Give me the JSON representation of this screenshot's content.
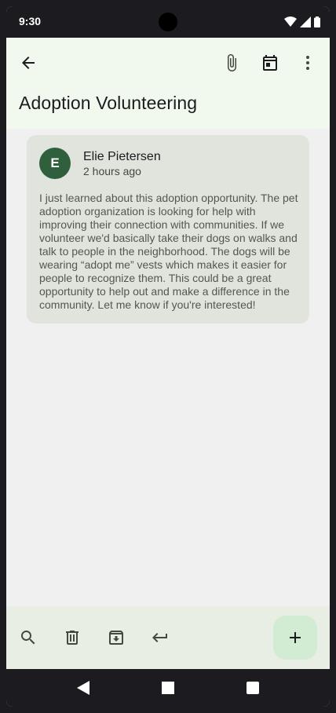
{
  "status": {
    "time": "9:30"
  },
  "header": {
    "title": "Adoption Volunteering"
  },
  "message": {
    "avatar_letter": "E",
    "sender": "Elie Pietersen",
    "time_ago": "2 hours ago",
    "body": "I just learned about this adoption opportunity. The pet adoption organization is looking for help with improving their connection with communities. If we volunteer we'd basically take their dogs on walks and talk to people in the neighborhood. The dogs will be wearing “adopt me” vests which makes it easier for people to recognize them. This could be a great opportunity to help out and make a difference in the community. Let me know if you're interested!"
  },
  "colors": {
    "avatar": "#2f5f3c",
    "top_bar": "#f1f8ee",
    "card": "#e0e4dd",
    "fab": "#d2ecd4"
  },
  "icons": {
    "top_bar": [
      "arrow-back-icon",
      "attach-icon",
      "calendar-icon",
      "more-vert-icon"
    ],
    "bottom_bar": [
      "search-icon",
      "delete-icon",
      "archive-icon",
      "reply-icon",
      "add-icon"
    ],
    "nav": [
      "nav-back-icon",
      "nav-home-icon",
      "nav-recents-icon"
    ]
  }
}
